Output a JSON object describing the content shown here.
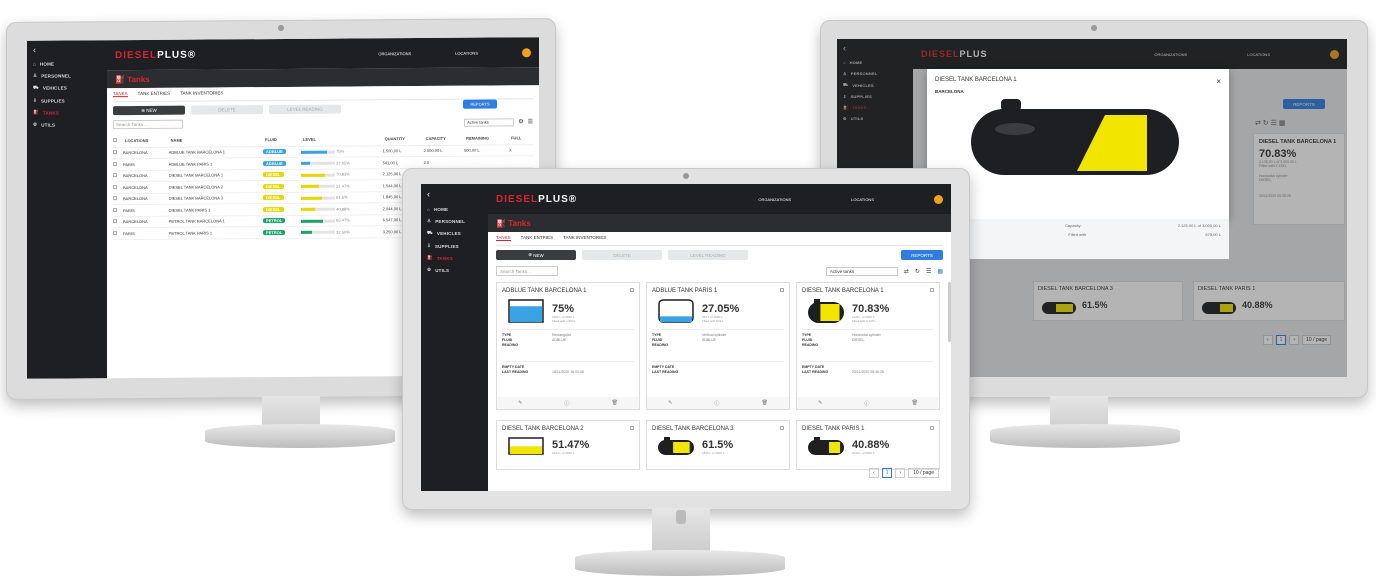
{
  "brand": {
    "name": "DIESEL",
    "suffix": "PLUS",
    "mark": "®"
  },
  "topbar": {
    "organizations": "ORGANIZATIONS",
    "locations": "LOCATIONS"
  },
  "nav": [
    "HOME",
    "PERSONNEL",
    "VEHICLES",
    "SUPPLIES",
    "TANKS",
    "UTILS"
  ],
  "page_title": "Tanks",
  "tabs": [
    "TANKS",
    "TANK ENTRIES",
    "TANK INVENTORIES"
  ],
  "actions": {
    "new": "NEW",
    "delete": "DELETE",
    "level_reading": "LEVEL READING",
    "reports": "REPORTS"
  },
  "search_placeholder": "Search Tanks...",
  "filter": "Active tanks",
  "table": {
    "headers": [
      "LOCATIONS",
      "NAME",
      "FLUID",
      "LEVEL",
      "QUANTITY",
      "CAPACITY",
      "REMAINING",
      "FULL"
    ],
    "rows": [
      {
        "location": "BARCELONA",
        "name": "ADBLUE TANK BARCELONA 1",
        "fluid": "ADBLUE",
        "level": 75,
        "level_text": "75%",
        "quantity": "1.500,00 L",
        "capacity": "2.000,00 L",
        "remaining": "500,00 L",
        "full": "X",
        "color": "#3aa3e3"
      },
      {
        "location": "PARIS",
        "name": "ADBLUE TANK PARIS 1",
        "fluid": "ADBLUE",
        "level": 27.05,
        "level_text": "27.05%",
        "quantity": "541,00 L",
        "capacity": "2.0",
        "remaining": "",
        "full": "",
        "color": "#3aa3e3"
      },
      {
        "location": "BARCELONA",
        "name": "DIESEL TANK BARCELONA 1",
        "fluid": "DIESEL",
        "level": 70.83,
        "level_text": "70.83%",
        "quantity": "2.125,00 L",
        "capacity": "3.0",
        "remaining": "",
        "full": "",
        "color": "#e6d800"
      },
      {
        "location": "BARCELONA",
        "name": "DIESEL TANK BARCELONA 2",
        "fluid": "DIESEL",
        "level": 51.47,
        "level_text": "51.47%",
        "quantity": "1.544,00 L",
        "capacity": "3.0",
        "remaining": "",
        "full": "",
        "color": "#e6d800"
      },
      {
        "location": "BARCELONA",
        "name": "DIESEL TANK BARCELONA 3",
        "fluid": "DIESEL",
        "level": 61.5,
        "level_text": "61.5%",
        "quantity": "1.845,00 L",
        "capacity": "3.0",
        "remaining": "",
        "full": "",
        "color": "#e6d800"
      },
      {
        "location": "PARIS",
        "name": "DIESEL TANK PARIS 1",
        "fluid": "DIESEL",
        "level": 40.88,
        "level_text": "40.88%",
        "quantity": "2.044,00 L",
        "capacity": "5.0",
        "remaining": "",
        "full": "",
        "color": "#e6d800"
      },
      {
        "location": "BARCELONA",
        "name": "PETROL TANK BARCELONA 1",
        "fluid": "PETROL",
        "level": 65.47,
        "level_text": "65.47%",
        "quantity": "6.547,00 L",
        "capacity": "10.0",
        "remaining": "",
        "full": "",
        "color": "#1aa36b"
      },
      {
        "location": "PARIS",
        "name": "PETROL TANK PARIS 1",
        "fluid": "PETROL",
        "level": 32.5,
        "level_text": "32.50%",
        "quantity": "3.250,00 L",
        "capacity": "10.0",
        "remaining": "",
        "full": "",
        "color": "#1aa36b"
      }
    ]
  },
  "cards": [
    {
      "name": "ADBLUE TANK BARCELONA 1",
      "pct": "75%",
      "level": 75,
      "sub1": "1500 L of 2000 L",
      "sub2": "Filled with 1.500 L",
      "type": "Rectangular",
      "fluid": "ADBLUE",
      "reading": "",
      "last": "18/11/2020 16:03:08",
      "color": "#3aa3e3",
      "shape": "rect"
    },
    {
      "name": "ADBLUE TANK PARIS 1",
      "pct": "27.05%",
      "level": 27.05,
      "sub1": "541 L of 2000 L",
      "sub2": "Filled with 541 L",
      "type": "Vertical cylinder",
      "fluid": "ADBLUE",
      "reading": "",
      "last": "",
      "color": "#3aa3e3",
      "shape": "vcyl"
    },
    {
      "name": "DIESEL TANK BARCELONA 1",
      "pct": "70.83%",
      "level": 70.83,
      "sub1": "2125 L of 3000 L",
      "sub2": "Filled with 2.125 L",
      "type": "Horizontal cylinder",
      "fluid": "DIESEL",
      "reading": "",
      "last": "20/11/2020 05:35:26",
      "color": "#f2e600",
      "shape": "hcyl"
    },
    {
      "name": "DIESEL TANK BARCELONA 2",
      "pct": "51.47%",
      "level": 51.47,
      "sub1": "1544 L of 3000 L",
      "sub2": "",
      "type": "",
      "fluid": "",
      "reading": "",
      "last": "",
      "color": "#f2e600",
      "shape": "rect"
    },
    {
      "name": "DIESEL TANK BARCELONA 3",
      "pct": "61.5%",
      "level": 61.5,
      "sub1": "1845 L of 3000 L",
      "sub2": "",
      "type": "",
      "fluid": "",
      "reading": "",
      "last": "",
      "color": "#f2e600",
      "shape": "hcyl"
    },
    {
      "name": "DIESEL TANK PARIS 1",
      "pct": "40.88%",
      "level": 40.88,
      "sub1": "2044 L of 5000 L",
      "sub2": "",
      "type": "",
      "fluid": "",
      "reading": "",
      "last": "",
      "color": "#f2e600",
      "shape": "hcyl"
    }
  ],
  "card_labels": {
    "type": "TYPE",
    "fluid": "FLUID",
    "reading": "READING",
    "empty_date": "EMPTY DATE",
    "last_reading": "LAST READING"
  },
  "pagination": {
    "page": "1",
    "per_page": "10 / page"
  },
  "modal": {
    "title": "DIESEL TANK BARCELONA 1",
    "location": "BARCELONA",
    "level": 70.83,
    "close": "×",
    "type_value": "Horizontal cylinder",
    "fluid_value": "DIESEL",
    "capacity_label": "Capacity",
    "capacity_value": "2.125,00 L of 3.000,00 L",
    "filled_label": "Filled with",
    "filled_value": "875,00 L"
  },
  "right_cards": [
    {
      "name": "DIESEL TANK BARCELONA 1",
      "pct": "70.83%",
      "sub1": "2.125,00 L of 3.000,00 L",
      "sub2": "Filled with 2.125 L",
      "type": "Horizontal cylinder",
      "fluid": "DIESEL",
      "last": "20/11/2020 05:35:26"
    },
    {
      "name": "DIESEL TANK BARCELONA 3",
      "pct": "61.5%",
      "level": 61.5
    },
    {
      "name": "DIESEL TANK PARIS 1",
      "pct": "40.88%",
      "level": 40.88
    }
  ],
  "colors": {
    "brand_red": "#d8262d",
    "dark": "#1d1f22",
    "blue": "#2f7de1",
    "diesel": "#f2e600",
    "adblue": "#3aa3e3",
    "petrol": "#1aa36b"
  }
}
